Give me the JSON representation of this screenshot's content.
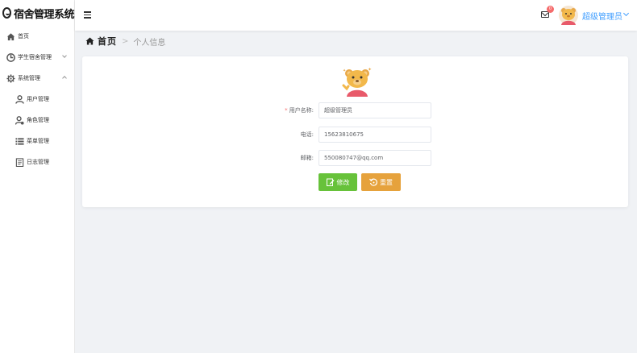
{
  "app": {
    "title": "宿舍管理系统"
  },
  "sidebar": {
    "items": [
      {
        "label": "首页",
        "icon": "home-icon"
      },
      {
        "label": "学生宿舍管理",
        "icon": "dorm-icon"
      },
      {
        "label": "系统管理",
        "icon": "gear-icon"
      },
      {
        "label": "用户管理",
        "icon": "user-icon"
      },
      {
        "label": "角色管理",
        "icon": "role-icon"
      },
      {
        "label": "菜单管理",
        "icon": "list-icon"
      },
      {
        "label": "日志管理",
        "icon": "log-icon"
      }
    ]
  },
  "header": {
    "badge_count": "0",
    "user_name": "超级管理员"
  },
  "breadcrumb": {
    "home": "首页",
    "separator": ">",
    "current": "个人信息"
  },
  "form": {
    "username_label": "用户名称:",
    "username_required": "*",
    "username_value": "超级管理员",
    "phone_label": "电话:",
    "phone_value": "15623810675",
    "email_label": "邮箱:",
    "email_value": "550080747@qq.com",
    "edit_button": "修改",
    "reset_button": "重置"
  },
  "colors": {
    "primary": "#409eff",
    "success": "#67c23a",
    "warning": "#e6a23c",
    "danger": "#f56c6c"
  }
}
